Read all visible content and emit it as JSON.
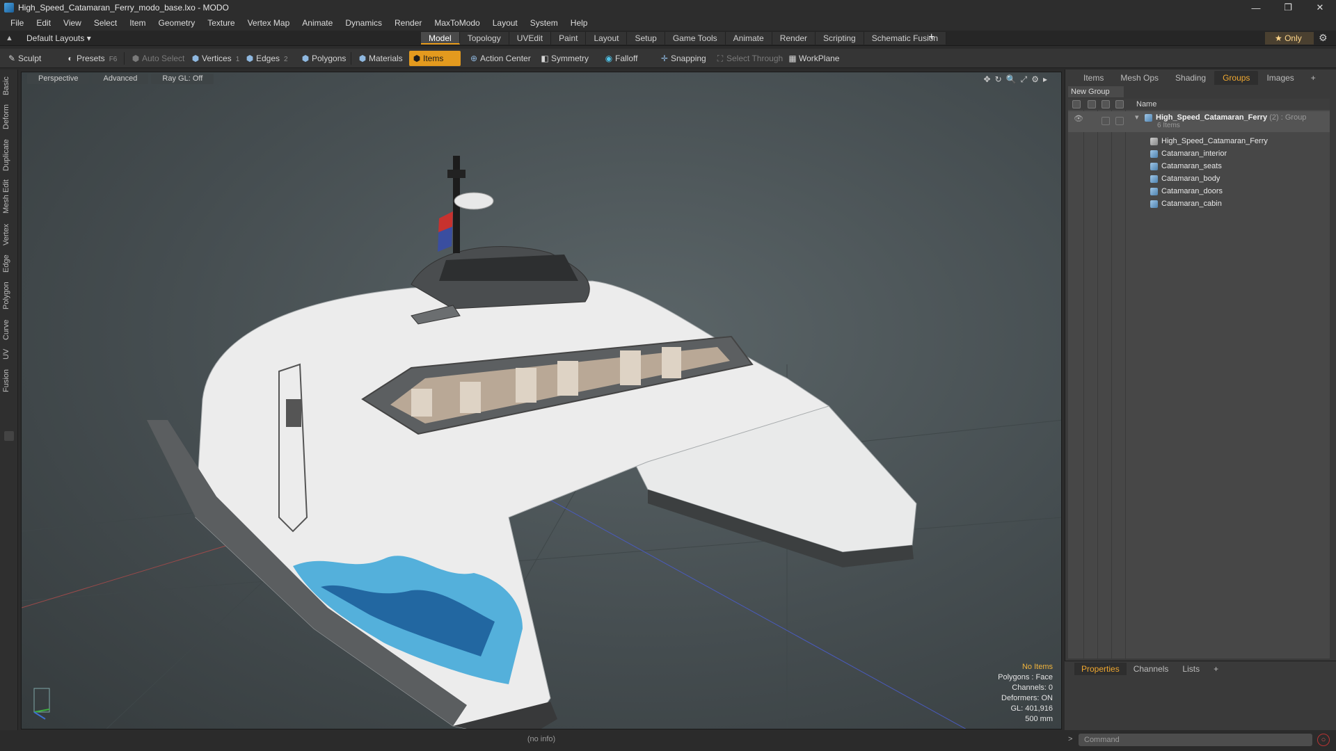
{
  "window": {
    "title": "High_Speed_Catamaran_Ferry_modo_base.lxo - MODO",
    "controls": [
      "—",
      "❐",
      "✕"
    ]
  },
  "menu": [
    "File",
    "Edit",
    "View",
    "Select",
    "Item",
    "Geometry",
    "Texture",
    "Vertex Map",
    "Animate",
    "Dynamics",
    "Render",
    "MaxToModo",
    "Layout",
    "System",
    "Help"
  ],
  "layoutbar": {
    "layout_name": "Default Layouts ▾",
    "tabs": [
      "Model",
      "Topology",
      "UVEdit",
      "Paint",
      "Layout",
      "Setup",
      "Game Tools",
      "Animate",
      "Render",
      "Scripting",
      "Schematic Fusion"
    ],
    "active_tab": "Model",
    "plus": "+",
    "only_label": "★ Only",
    "gear": "⚙"
  },
  "toolbar": {
    "sculpt": "Sculpt",
    "presets": "Presets",
    "presets_key": "F6",
    "auto_select": "Auto Select",
    "vertices": "Vertices",
    "vertices_count": "1",
    "edges": "Edges",
    "edges_count": "2",
    "polygons": "Polygons",
    "materials": "Materials",
    "items": "Items",
    "action_center": "Action Center",
    "symmetry": "Symmetry",
    "falloff": "Falloff",
    "snapping": "Snapping",
    "select_through": "Select Through",
    "workplane": "WorkPlane"
  },
  "lefttabs": [
    "Basic",
    "Deform",
    "Duplicate",
    "Mesh Edit",
    "Vertex",
    "Edge",
    "Polygon",
    "Curve",
    "UV",
    "Fusion"
  ],
  "viewport": {
    "view": "Perspective",
    "shading": "Advanced",
    "raygl": "Ray GL: Off",
    "icons": [
      "✥",
      "↻",
      "🔍",
      "⤢",
      "⚙",
      "▸"
    ],
    "info": {
      "no_items": "No Items",
      "polygons": "Polygons : Face",
      "channels": "Channels: 0",
      "deformers": "Deformers: ON",
      "gl": "GL: 401,916",
      "scale": "500 mm"
    }
  },
  "status": "(no info)",
  "rightpanel": {
    "tabs": [
      "Items",
      "Mesh Ops",
      "Shading",
      "Groups",
      "Images",
      "+"
    ],
    "active_tab": "Groups",
    "new_group": "New Group",
    "column_name": "Name",
    "group": {
      "name": "High_Speed_Catamaran_Ferry",
      "extra": " (2) : Group",
      "count": "6 Items"
    },
    "children": [
      "High_Speed_Catamaran_Ferry",
      "Catamaran_interior",
      "Catamaran_seats",
      "Catamaran_body",
      "Catamaran_doors",
      "Catamaran_cabin"
    ]
  },
  "bottompanel": {
    "tabs": [
      "Properties",
      "Channels",
      "Lists",
      "+"
    ],
    "active_tab": "Properties",
    "command_placeholder": "Command"
  },
  "colors": {
    "accent": "#e39a1e",
    "panel": "#3a3a3a",
    "tree": "#474747"
  }
}
